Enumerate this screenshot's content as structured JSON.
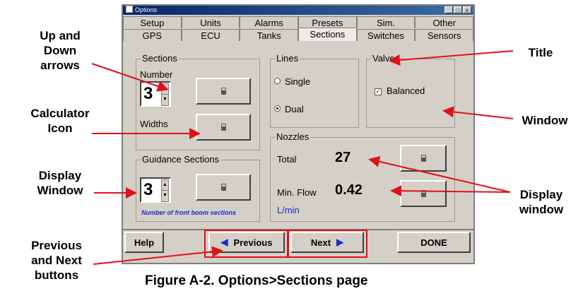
{
  "window": {
    "title": "Options",
    "controls": [
      "_",
      "□",
      "x"
    ],
    "tabs_row1": [
      "Setup",
      "Units",
      "Alarms",
      "Presets",
      "Sim.",
      "Other"
    ],
    "tabs_row2": [
      "GPS",
      "ECU",
      "Tanks",
      "Sections",
      "Switches",
      "Sensors"
    ],
    "active_tab": "Sections"
  },
  "sections_group": {
    "legend": "Sections",
    "number_label": "Number",
    "number_value": "3",
    "widths_label": "Widths"
  },
  "guidance_group": {
    "legend": "Guidance Sections",
    "value": "3",
    "note": "Number of front boom sections"
  },
  "lines_group": {
    "legend": "Lines",
    "single": "Single",
    "dual": "Dual",
    "selected": "Dual"
  },
  "valves_group": {
    "legend": "Valves",
    "balanced": "Balanced",
    "balanced_checked": true
  },
  "nozzles_group": {
    "legend": "Nozzles",
    "total_label": "Total",
    "total_value": "27",
    "min_flow_label": "Min. Flow",
    "min_flow_value": "0.42",
    "unit": "L/min"
  },
  "footer": {
    "help": "Help",
    "previous": "Previous",
    "next": "Next",
    "done": "DONE"
  },
  "annotations": {
    "up_down_arrows": [
      "Up and",
      "Down",
      "arrows"
    ],
    "calculator_icon": [
      "Calculator",
      "Icon"
    ],
    "display_window_left": [
      "Display",
      "Window"
    ],
    "previous_next": [
      "Previous",
      "and Next",
      "buttons"
    ],
    "title": "Title",
    "window": "Window",
    "display_window_right": [
      "Display",
      "window"
    ]
  },
  "caption": "Figure A-2. Options>Sections page",
  "colors": {
    "annotation_red": "#e0101a",
    "blue_text": "#1c2bd0",
    "window_bg": "#d4d0c8"
  }
}
